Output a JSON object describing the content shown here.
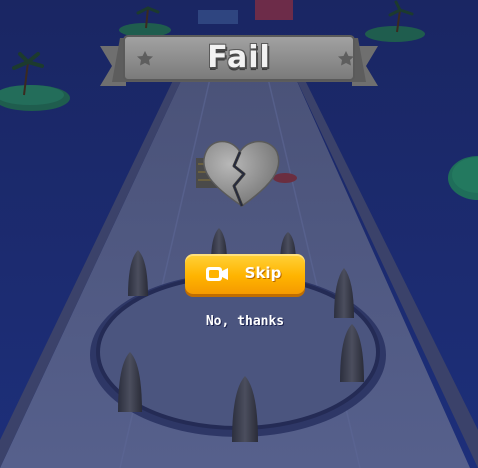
{
  "banner": {
    "title": "Fail"
  },
  "icons": {
    "result": "broken-heart-icon",
    "skip": "video-ad-icon",
    "banner_deco": "star-icon"
  },
  "buttons": {
    "skip_label": "Skip",
    "decline_label": "No, thanks"
  },
  "colors": {
    "ocean": "#1b2a6e",
    "road": "#4f5b88",
    "banner": "#8c8c8c",
    "skip_button": "#ffb400",
    "island": "#1f6e5a"
  }
}
